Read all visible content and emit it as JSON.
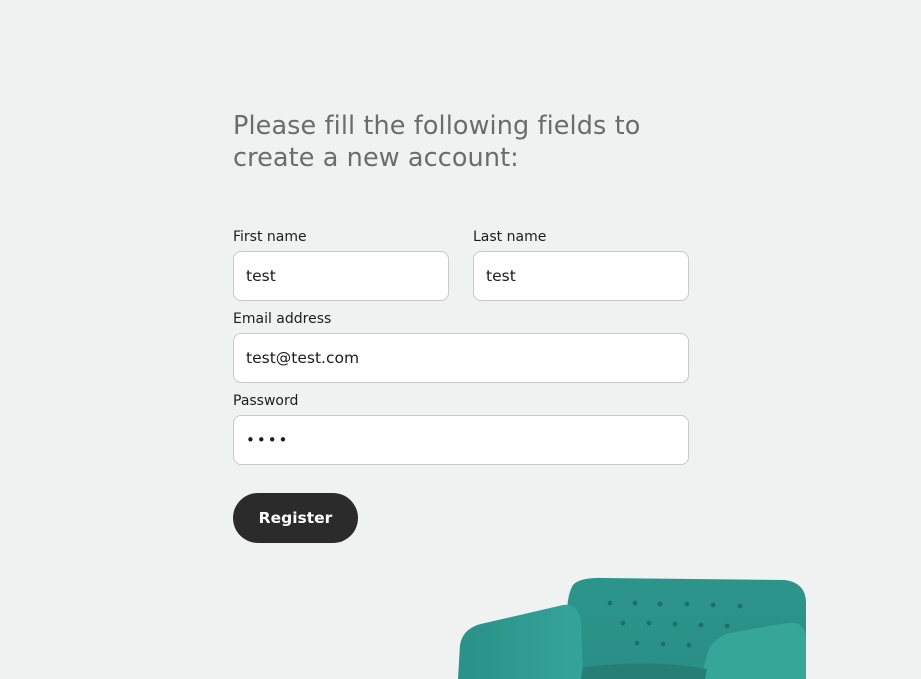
{
  "form": {
    "heading": "Please fill the following fields to create a new account:",
    "first_name": {
      "label": "First name",
      "value": "test"
    },
    "last_name": {
      "label": "Last name",
      "value": "test"
    },
    "email": {
      "label": "Email address",
      "value": "test@test.com"
    },
    "password": {
      "label": "Password",
      "value": "••••"
    },
    "register_label": "Register"
  },
  "colors": {
    "background": "#f0f2f1",
    "heading": "#6b6d6c",
    "button": "#2b2b2b",
    "chair": "#2f9a90"
  },
  "images": {
    "chair": "teal-armchair-image"
  }
}
